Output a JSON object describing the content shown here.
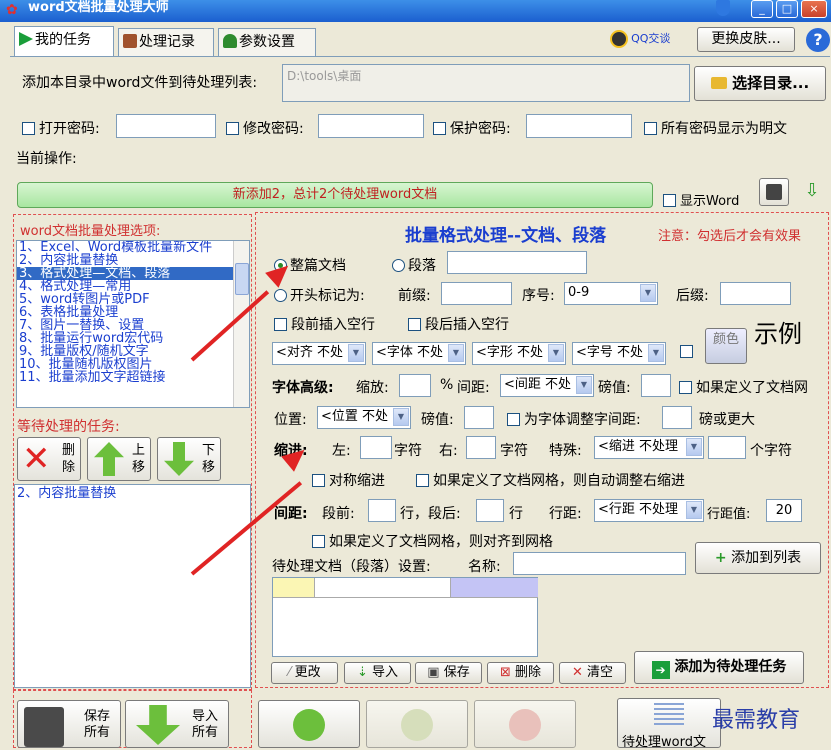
{
  "window": {
    "title": "word文档批量处理大师"
  },
  "tabs": [
    {
      "label": "我的任务",
      "active": true
    },
    {
      "label": "处理记录",
      "active": false
    },
    {
      "label": "参数设置",
      "active": false
    }
  ],
  "header": {
    "qq_label": "QQ交谈",
    "skin_button": "更换皮肤...",
    "help_icon": "?"
  },
  "dir": {
    "label": "添加本目录中word文件到待处理列表:",
    "value": "D:\\tools\\桌面",
    "select_button": "选择目录..."
  },
  "passwords": {
    "open": "打开密码:",
    "modify": "修改密码:",
    "protect": "保护密码:",
    "show_plain": "所有密码显示为明文"
  },
  "current_op": {
    "label": "当前操作:",
    "status": "新添加2，总计2个待处理word文档",
    "show_word": "显示Word"
  },
  "options": {
    "title": "word文档批量处理选项:",
    "items": [
      "1、Excel、Word模板批量新文件",
      "2、内容批量替换",
      "3、格式处理—文档、段落",
      "4、格式处理—常用",
      "5、word转图片或PDF",
      "6、表格批量处理",
      "7、图片一替换、设置",
      "8、批量运行word宏代码",
      "9、批量版权/随机文字",
      "10、批量随机版权图片",
      "11、批量添加文字超链接"
    ],
    "selected_index": 2
  },
  "pending": {
    "title": "等待处理的任务:",
    "delete": "删除",
    "up": "上移",
    "down": "下移",
    "items": [
      "2、内容批量替换"
    ]
  },
  "format": {
    "title": "批量格式处理--文档、段落",
    "note": "注意：勾选后才会有效果",
    "whole_doc": "整篇文档",
    "paragraph": "段落",
    "start_mark": "开头标记为:",
    "prefix": "前缀:",
    "seq": "序号:",
    "seq_value": "0-9",
    "suffix": "后缀:",
    "insert_before": "段前插入空行",
    "insert_after": "段后插入空行",
    "align": "<对齐 不处",
    "font": "<字体 不处",
    "style": "<字形 不处",
    "size": "<字号 不处",
    "color": "颜色",
    "sample": "示例",
    "font_adv": "字体高级:",
    "scale": "缩放:",
    "pct": "%",
    "spacing": "间距:",
    "spacing_combo": "<间距 不处",
    "pound": "磅值:",
    "grid_if": "如果定义了文档网",
    "position": "位置:",
    "position_combo": "<位置 不处",
    "pound2": "磅值:",
    "adjust_kern": "为字体调整字间距:",
    "pound_more": "磅或更大",
    "indent": "缩进:",
    "left": "左:",
    "char1": "字符",
    "right": "右:",
    "char2": "字符",
    "special": "特殊:",
    "special_combo": "<缩进 不处理",
    "chars": "个字符",
    "sym_indent": "对称缩进",
    "grid_auto": "如果定义了文档网格，则自动调整右缩进",
    "line_spacing": "间距:",
    "before": "段前:",
    "row_after": "行，段后:",
    "row": "行",
    "line_dist": "行距:",
    "line_dist_combo": "<行距 不处理",
    "line_val": "行距值:",
    "line_val_value": "20",
    "grid_align": "如果定义了文档网格，则对齐到网格",
    "para_settings": "待处理文档（段落）设置:",
    "name": "名称:",
    "add_list": "添加到列表",
    "modify": "更改",
    "import": "导入",
    "save": "保存",
    "delete": "删除",
    "clear": "清空",
    "add_task": "添加为待处理任务"
  },
  "bottom": {
    "save_all": "保存所有",
    "import_all": "导入所有",
    "pending_docs": "待处理word文",
    "watermark": "最需教育"
  },
  "colors": {
    "accent_red": "#e02424",
    "title_blue": "#1a3ecf",
    "status_green": "#a8e6a0"
  }
}
